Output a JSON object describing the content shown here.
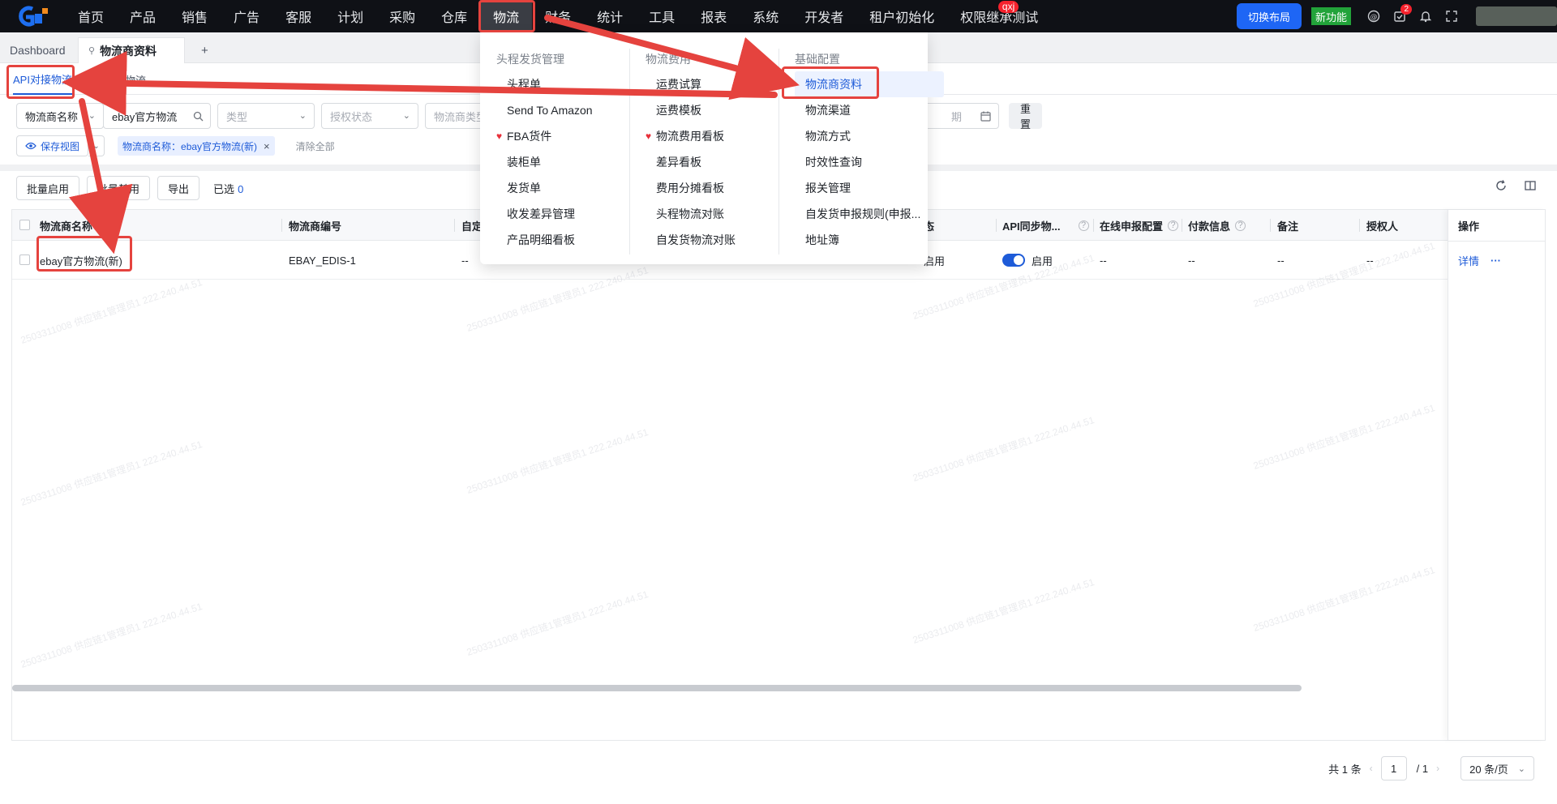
{
  "topnav": {
    "items": [
      "首页",
      "产品",
      "销售",
      "广告",
      "客服",
      "计划",
      "采购",
      "仓库",
      "物流",
      "财务",
      "统计",
      "工具",
      "报表",
      "系统",
      "开发者",
      "租户初始化",
      "权限继承测试"
    ],
    "active_index": 8,
    "user_badge": "qxj",
    "switch_layout": "切换布局",
    "new_feature": "新功能",
    "todo_count": "2"
  },
  "tabs": {
    "dashboard": "Dashboard",
    "current": "物流商资料",
    "add": "+"
  },
  "subtabs": {
    "api": "API对接物流",
    "custom": "自定义物流"
  },
  "filters": {
    "name_field": "物流商名称",
    "name_value": "ebay官方物流",
    "type_placeholder": "类型",
    "auth_placeholder": "授权状态",
    "logistics_type_placeholder": "物流商类型",
    "date_placeholder": "期",
    "reset": "重置"
  },
  "views": {
    "save_view": "保存视图",
    "chip": "物流商名称：ebay官方物流(新)",
    "clear_all": "清除全部"
  },
  "toolbar": {
    "batch_enable": "批量启用",
    "batch_disable": "批量禁用",
    "export": "导出",
    "selected_label": "已选",
    "selected_count": "0"
  },
  "table": {
    "headers": {
      "name": "物流商名称",
      "code": "物流商编号",
      "custom": "自定",
      "status": "态",
      "api_sync": "API同步物...",
      "online_declare": "在线申报配置",
      "payment": "付款信息",
      "remark": "备注",
      "authorizer": "授权人",
      "ops": "操作"
    },
    "row": {
      "name": "ebay官方物流(新)",
      "code": "EBAY_EDIS-1",
      "custom": "--",
      "status": "启用",
      "api_sync": "启用",
      "online_declare": "--",
      "payment": "--",
      "remark": "--",
      "authorizer": "--",
      "detail": "详情",
      "more": "···"
    }
  },
  "pager": {
    "total": "共 1 条",
    "page": "1",
    "of": "/ 1",
    "size": "20 条/页"
  },
  "menu": {
    "col1": {
      "title": "头程发货管理",
      "items": [
        "头程单",
        "Send To Amazon",
        "FBA货件",
        "装柜单",
        "发货单",
        "收发差异管理",
        "产品明细看板"
      ]
    },
    "col2": {
      "title": "物流费用",
      "items": [
        "运费试算",
        "运费模板",
        "物流费用看板",
        "差异看板",
        "费用分摊看板",
        "头程物流对账",
        "自发货物流对账"
      ]
    },
    "col3": {
      "title": "基础配置",
      "items": [
        "物流商资料",
        "物流渠道",
        "物流方式",
        "时效性查询",
        "报关管理",
        "自发货申报规则(申报...",
        "地址簿"
      ]
    }
  },
  "watermark": "2503311008 供应链1管理员1 222.240.44.51",
  "colors": {
    "accent": "#1e5bd8",
    "annotation": "#e5433e",
    "nav_bg": "#0f1116"
  }
}
